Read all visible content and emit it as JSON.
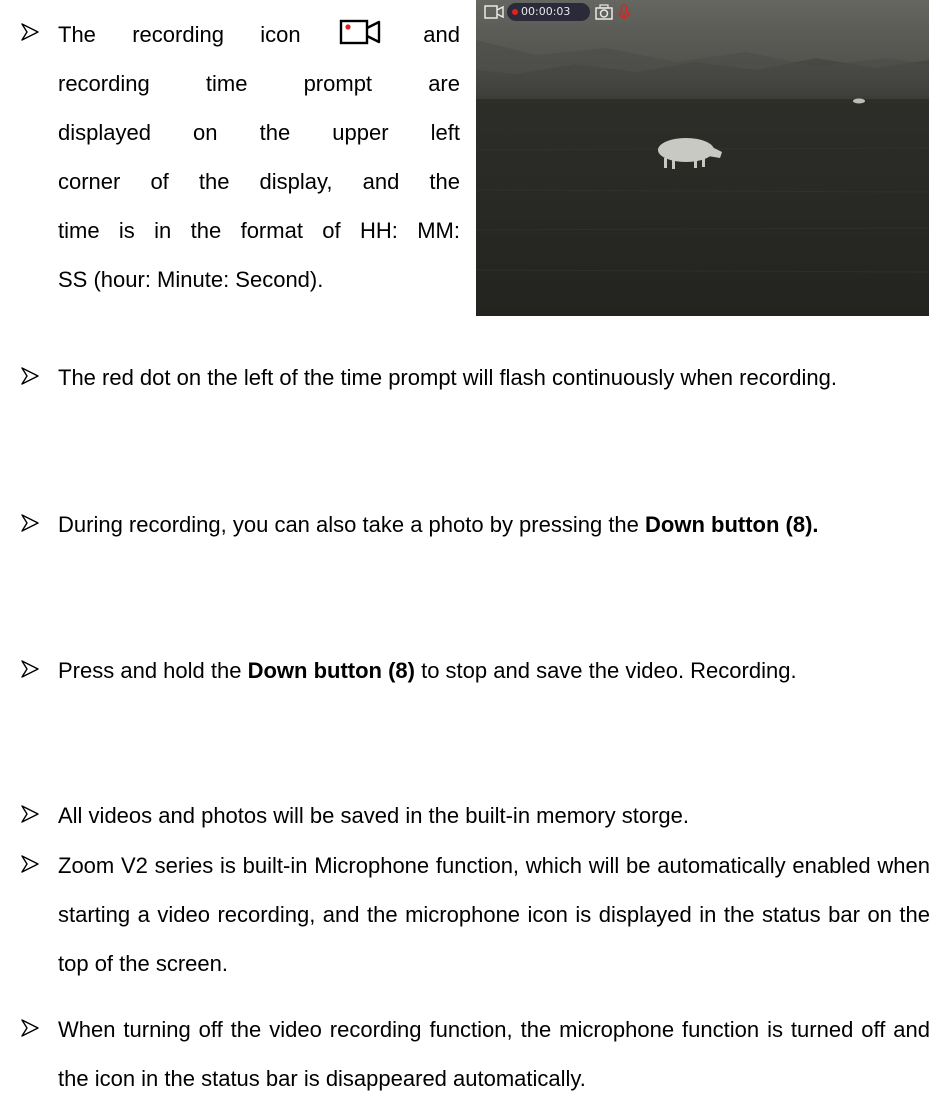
{
  "image": {
    "osd": {
      "time": "00:00:03",
      "icons": [
        "video-camera-icon",
        "camera-icon",
        "microphone-icon"
      ],
      "colors": {
        "rec_dot": "#e0221e",
        "mic": "#d8261f",
        "osd_white": "#e8e8e8"
      }
    }
  },
  "bullets": [
    {
      "lines": [
        "The recording icon",
        "and",
        "recording time prompt are",
        "displayed on the upper left",
        "corner of the display, and the",
        "time is in the format of HH: MM:",
        "SS (hour: Minute: Second)."
      ]
    },
    {
      "text": "The red dot on the left of the time prompt will flash continuously when recording."
    },
    {
      "pre": "During recording, you can also take a photo by pressing the ",
      "bold": "Down button (8).",
      "post": ""
    },
    {
      "pre": "Press and hold the ",
      "bold": "Down button (8)",
      "post": " to stop and save the video. Recording."
    },
    {
      "text": "All videos and photos will be saved in the built-in memory storge."
    },
    {
      "text": "Zoom V2 series is built-in Microphone function, which will be automatically enabled when starting a video recording, and the microphone icon is displayed in the status bar on the top of the screen."
    },
    {
      "text": "When turning off the video recording function, the microphone function is turned off and the icon in the status bar is disappeared automatically."
    }
  ],
  "icons": {
    "bullet": "arrowhead-bullet-icon",
    "inline": "recording-icon"
  }
}
